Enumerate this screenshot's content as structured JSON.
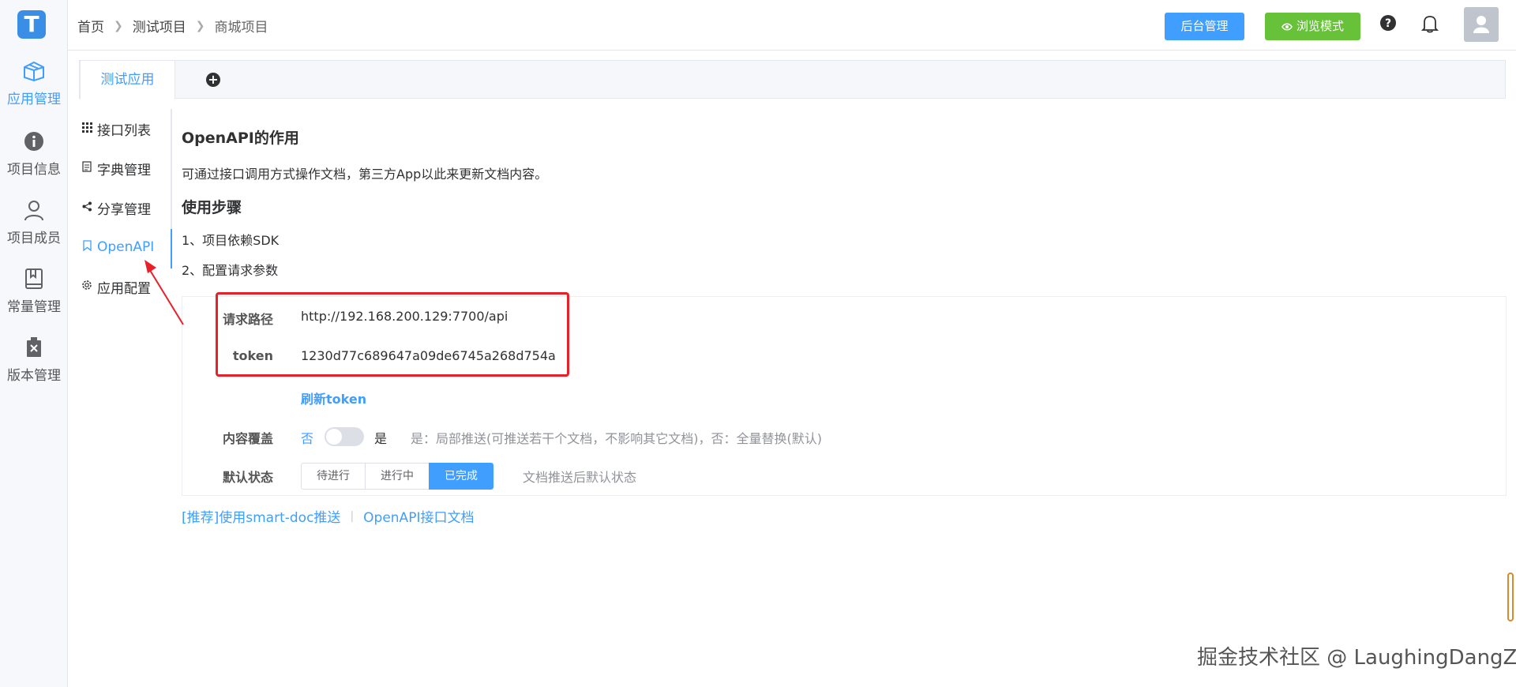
{
  "app": {
    "logo_letter": "T"
  },
  "rail": {
    "items": [
      {
        "label": "应用管理",
        "icon": "box-icon"
      },
      {
        "label": "项目信息",
        "icon": "info-icon"
      },
      {
        "label": "项目成员",
        "icon": "user-icon"
      },
      {
        "label": "常量管理",
        "icon": "book-icon"
      },
      {
        "label": "版本管理",
        "icon": "delete-doc-icon"
      }
    ]
  },
  "breadcrumb": {
    "home": "首页",
    "project": "测试项目",
    "current": "商城项目"
  },
  "header": {
    "admin_label": "后台管理",
    "browse_label": "浏览模式"
  },
  "tabs": {
    "active_label": "测试应用"
  },
  "menu": {
    "items": [
      {
        "label": "接口列表"
      },
      {
        "label": "字典管理"
      },
      {
        "label": "分享管理"
      },
      {
        "label": "OpenAPI"
      },
      {
        "label": "应用配置"
      }
    ]
  },
  "content": {
    "title": "OpenAPI的作用",
    "description": "可通过接口调用方式操作文档，第三方App以此来更新文档内容。",
    "steps_title": "使用步骤",
    "step1": "1、项目依赖SDK",
    "step2": "2、配置请求参数"
  },
  "form": {
    "path_label": "请求路径",
    "path_value": "http://192.168.200.129:7700/api",
    "token_label": "token",
    "token_value": "1230d77c689647a09de6745a268d754a",
    "refresh_label": "刷新token",
    "cover_label": "内容覆盖",
    "cover_off": "否",
    "cover_on": "是",
    "cover_hint": "是：局部推送(可推送若干个文档，不影响其它文档)，否：全量替换(默认)",
    "status_label": "默认状态",
    "status_options": [
      "待进行",
      "进行中",
      "已完成"
    ],
    "status_selected": "已完成",
    "status_hint": "文档推送后默认状态"
  },
  "links": {
    "smartdoc": "[推荐]使用smart-doc推送",
    "openapi_doc": "OpenAPI接口文档"
  },
  "watermark": "掘金技术社区 @ LaughingDangZi",
  "colors": {
    "primary": "#409eff",
    "success": "#67c23a",
    "annotation": "#e8202a"
  }
}
